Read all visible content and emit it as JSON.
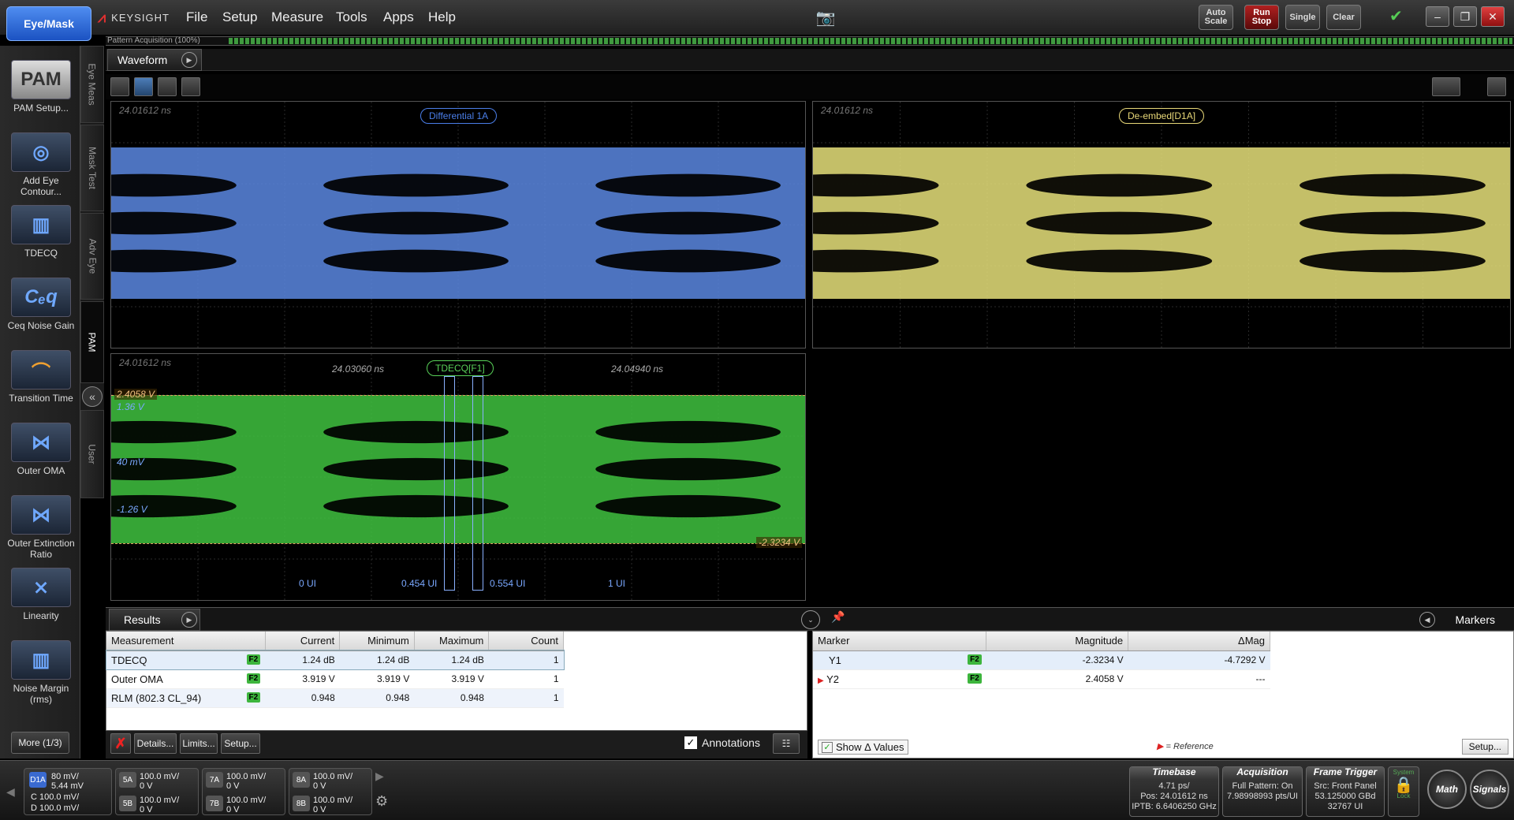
{
  "app": {
    "mode_button": "Eye/Mask",
    "brand": "KEYSIGHT"
  },
  "menu": [
    "File",
    "Setup",
    "Measure",
    "Tools",
    "Apps",
    "Help"
  ],
  "toolbar": {
    "auto_scale": "Auto Scale",
    "run_stop": "Run Stop",
    "single": "Single",
    "clear": "Clear"
  },
  "acquisition": {
    "label": "Pattern Acquisition",
    "percent": "(100%)",
    "progress": 1.0
  },
  "left_tools": [
    {
      "label": "PAM Setup...",
      "icon": "PAM"
    },
    {
      "label": "Add Eye Contour...",
      "icon": "eye-contour"
    },
    {
      "label": "TDECQ",
      "icon": "tdecq"
    },
    {
      "label": "Ceq Noise Gain",
      "icon": "Ceq"
    },
    {
      "label": "Transition Time",
      "icon": "transition"
    },
    {
      "label": "Outer OMA",
      "icon": "oma"
    },
    {
      "label": "Outer Extinction Ratio",
      "icon": "extinction"
    },
    {
      "label": "Linearity",
      "icon": "linearity"
    },
    {
      "label": "Noise Margin (rms)",
      "icon": "noise"
    }
  ],
  "more_button": "More (1/3)",
  "vertical_tabs": [
    "Eye Meas",
    "Mask Test",
    "Adv Eye",
    "PAM",
    "User"
  ],
  "waveform": {
    "tab": "Waveform",
    "plots": [
      {
        "label": "Differential 1A",
        "timestamp": "24.01612 ns",
        "color": "#5a87e0",
        "label_color": "#4a7ee8"
      },
      {
        "label": "De-embed[D1A]",
        "timestamp": "24.01612 ns",
        "color": "#e6e07a",
        "label_color": "#e8d878"
      },
      {
        "label": "TDECQ[F1]",
        "timestamp": "24.01612 ns",
        "color": "#3fc23f",
        "label_color": "#58d058",
        "time_left": "24.03060 ns",
        "time_right": "24.04940 ns",
        "levels": [
          "2.4058 V",
          "1.36 V",
          "40 mV",
          "-1.26 V",
          "-2.3234 V"
        ],
        "ui_labels": [
          "0 UI",
          "0.454 UI",
          "0.554 UI",
          "1 UI"
        ]
      }
    ]
  },
  "results": {
    "tab": "Results",
    "columns": [
      "Measurement",
      "Current",
      "Minimum",
      "Maximum",
      "Count"
    ],
    "rows": [
      {
        "name": "TDECQ",
        "badge": "F2",
        "current": "1.24 dB",
        "minimum": "1.24 dB",
        "maximum": "1.24 dB",
        "count": "1"
      },
      {
        "name": "Outer OMA",
        "badge": "F2",
        "current": "3.919 V",
        "minimum": "3.919 V",
        "maximum": "3.919 V",
        "count": "1"
      },
      {
        "name": "RLM (802.3 CL_94)",
        "badge": "F2",
        "current": "0.948",
        "minimum": "0.948",
        "maximum": "0.948",
        "count": "1"
      }
    ],
    "footer": {
      "details": "Details...",
      "limits": "Limits...",
      "setup": "Setup...",
      "annotations": "Annotations",
      "annotations_checked": true
    }
  },
  "markers": {
    "tab": "Markers",
    "columns": [
      "Marker",
      "Magnitude",
      "ΔMag"
    ],
    "rows": [
      {
        "name": "Y1",
        "badge": "F2",
        "magnitude": "-2.3234 V",
        "dmag": "-4.7292 V"
      },
      {
        "name": "Y2",
        "badge": "F2",
        "magnitude": "2.4058 V",
        "dmag": "---"
      }
    ],
    "show_delta": "Show Δ Values",
    "show_delta_checked": true,
    "reference_note": "= Reference",
    "setup": "Setup..."
  },
  "channels": [
    {
      "tag": "D1A",
      "lines": [
        "80 mV/",
        "5.44 mV",
        "100.0 mV/",
        "100.0 mV/"
      ],
      "sub": [
        "C",
        "D"
      ]
    },
    {
      "tag": "5A",
      "lines": [
        "100.0 mV/",
        "0 V"
      ]
    },
    {
      "tag": "5B",
      "lines": [
        "100.0 mV/",
        "0 V"
      ]
    },
    {
      "tag": "7A",
      "lines": [
        "100.0 mV/",
        "0 V"
      ]
    },
    {
      "tag": "7B",
      "lines": [
        "100.0 mV/",
        "0 V"
      ]
    },
    {
      "tag": "8A",
      "lines": [
        "100.0 mV/",
        "0 V"
      ]
    },
    {
      "tag": "8B",
      "lines": [
        "100.0 mV/",
        "0 V"
      ]
    }
  ],
  "status": {
    "timebase": {
      "title": "Timebase",
      "lines": [
        "4.71 ps/",
        "Pos: 24.01612 ns",
        "IPTB: 6.6406250 GHz"
      ]
    },
    "acquisition": {
      "title": "Acquisition",
      "lines": [
        "Full Pattern: On",
        "7.98998993 pts/UI"
      ]
    },
    "frame_trigger": {
      "title": "Frame Trigger",
      "lines": [
        "Src: Front Panel",
        "53.125000 GBd",
        "32767 UI"
      ]
    },
    "system": "System",
    "lock": "Lock",
    "math": "Math",
    "signals": "Signals"
  }
}
